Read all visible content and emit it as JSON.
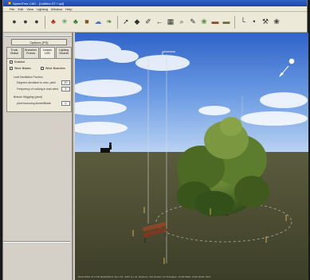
{
  "window": {
    "title": "SpeedTree CAD - [Untitled-ST-*.spt]"
  },
  "menu": [
    "File",
    "Edit",
    "View",
    "Lighting",
    "Window",
    "Help"
  ],
  "toolbar": [
    {
      "name": "new-file-icon",
      "glyph": "●",
      "color": "#3c3c3c"
    },
    {
      "name": "open-file-icon",
      "glyph": "●",
      "color": "#3c3c3c"
    },
    {
      "name": "save-file-icon",
      "glyph": "●",
      "color": "#3c3c3c"
    },
    {
      "name": "tree-object-icon",
      "glyph": "♣",
      "color": "#b22d1c"
    },
    {
      "name": "leaf-brush-icon",
      "glyph": "✳",
      "color": "#2e8b2e"
    },
    {
      "name": "forest-icon",
      "glyph": "♣",
      "color": "#2e7d2e"
    },
    {
      "name": "texture-icon",
      "glyph": "■",
      "color": "#7c5a1e"
    },
    {
      "name": "wind-icon",
      "glyph": "☁",
      "color": "#4a78c8"
    },
    {
      "name": "leaf-tool-icon",
      "glyph": "❧",
      "color": "#4a8a2e"
    },
    {
      "name": "select-tool-icon",
      "glyph": "➚",
      "color": "#333"
    },
    {
      "name": "move-tool-icon",
      "glyph": "◆",
      "color": "#333"
    },
    {
      "name": "brush-tool-icon",
      "glyph": "✐",
      "color": "#333"
    },
    {
      "name": "branch-tool-icon",
      "glyph": "←",
      "color": "#333"
    },
    {
      "name": "grid-icon",
      "glyph": "▦",
      "color": "#333"
    },
    {
      "name": "zoom-icon",
      "glyph": "⌕",
      "color": "#333"
    },
    {
      "name": "pencil-icon",
      "glyph": "✎",
      "color": "#333"
    },
    {
      "name": "flora-icon",
      "glyph": "❀",
      "color": "#4a8a2e"
    },
    {
      "name": "bench-icon",
      "glyph": "▬",
      "color": "#8a4a2a"
    },
    {
      "name": "ground-icon",
      "glyph": "▬",
      "color": "#6a6a3a"
    },
    {
      "name": "axis-icon",
      "glyph": "└",
      "color": "#333"
    },
    {
      "name": "light-icon",
      "glyph": "•",
      "color": "#333"
    },
    {
      "name": "wrench-icon",
      "glyph": "⚒",
      "color": "#333"
    },
    {
      "name": "help-icon",
      "glyph": "❀",
      "color": "#333"
    }
  ],
  "panel": {
    "title_button": "Options (PS)",
    "tabs": [
      {
        "label": "Trunk",
        "label2": "Global"
      },
      {
        "label": "Branches",
        "label2": "Fronds"
      },
      {
        "label": "Leaves",
        "label2": "LOD"
      },
      {
        "label": "Lighting",
        "label2": "Sounds"
      }
    ],
    "enabled_label": "Enabled",
    "checks": [
      {
        "label": "Wind: Blades",
        "checked": true
      },
      {
        "label": "Wind: Branches",
        "checked": true
      }
    ],
    "section1": "Leaf Oscillation Factors",
    "fields": [
      {
        "label": "Degrees deviation to max, pitch",
        "value": "20"
      },
      {
        "label": "Frequency of rocking in max wind",
        "value": "5"
      }
    ],
    "section2": "Branch Wiggling (pivot)",
    "fields2": [
      {
        "label": "pivot bouncing stroke/Blade",
        "value": "0"
      }
    ]
  },
  "status_text": "Wind  MPH  47  LOD  Right/Wind:  Fps  Vtx: 3457 (L) 21   (Frames: 34)  Nodes: 10  Triangles: 13.6K   Bark: 2123   Wind: 00.0"
}
